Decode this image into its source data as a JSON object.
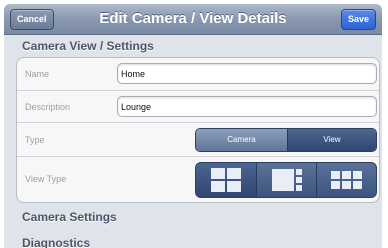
{
  "navbar": {
    "title": "Edit Camera / View Details",
    "cancel_label": "Cancel",
    "save_label": "Save"
  },
  "sections": {
    "camera_view_settings": "Camera View / Settings",
    "camera_settings": "Camera Settings",
    "diagnostics": "Diagnostics"
  },
  "form": {
    "name_label": "Name",
    "name_value": "Home",
    "description_label": "Description",
    "description_value": "Lounge",
    "type_label": "Type",
    "type_options": [
      "Camera",
      "View"
    ],
    "type_selected": "View",
    "view_type_label": "View Type",
    "view_type_options": [
      "grid-2x2-icon",
      "grid-1-plus-3-icon",
      "grid-3x2-icon"
    ],
    "view_type_selected": "grid-2x2-icon"
  },
  "colors": {
    "accent_save": "#2c62d4",
    "navbar": "#8a99b0",
    "segment_selected": "#2f4670"
  }
}
